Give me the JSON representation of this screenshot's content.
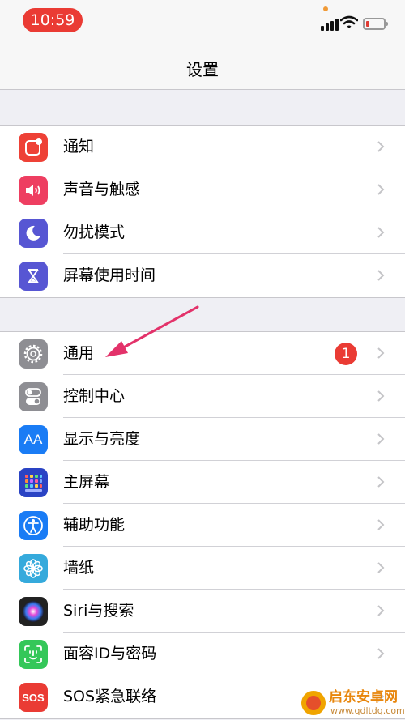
{
  "status_bar": {
    "time": "10:59"
  },
  "nav": {
    "title": "设置"
  },
  "groups": [
    {
      "items": [
        {
          "label": "通知",
          "icon": "notifications-icon",
          "color": "#ee4136"
        },
        {
          "label": "声音与触感",
          "icon": "speaker-icon",
          "color": "#ee3e61"
        },
        {
          "label": "勿扰模式",
          "icon": "moon-icon",
          "color": "#5756d3"
        },
        {
          "label": "屏幕使用时间",
          "icon": "hourglass-icon",
          "color": "#5756d3"
        }
      ]
    },
    {
      "items": [
        {
          "label": "通用",
          "icon": "gear-icon",
          "color": "#8e8e93",
          "badge": "1"
        },
        {
          "label": "控制中心",
          "icon": "toggles-icon",
          "color": "#8e8e93"
        },
        {
          "label": "显示与亮度",
          "icon": "text-size-icon",
          "text": "AA",
          "color": "#1a7cf5"
        },
        {
          "label": "主屏幕",
          "icon": "home-screen-grid-icon",
          "color": "#2a43c4"
        },
        {
          "label": "辅助功能",
          "icon": "accessibility-icon",
          "color": "#1a7cf5"
        },
        {
          "label": "墙纸",
          "icon": "flower-icon",
          "color": "#35aadc"
        },
        {
          "label": "Siri与搜索",
          "icon": "siri-icon",
          "color": "#222222"
        },
        {
          "label": "面容ID与密码",
          "icon": "face-id-icon",
          "color": "#34c759"
        },
        {
          "label": "SOS紧急联络",
          "icon": "sos-icon",
          "text": "SOS",
          "color": "#ea3b34"
        }
      ]
    }
  ],
  "watermark": {
    "title": "启东安卓网",
    "url": "www.qdltdq.com"
  },
  "colors": {
    "accent_red": "#ea3b34",
    "arrow": "#e3326a",
    "background": "#efeff4"
  }
}
